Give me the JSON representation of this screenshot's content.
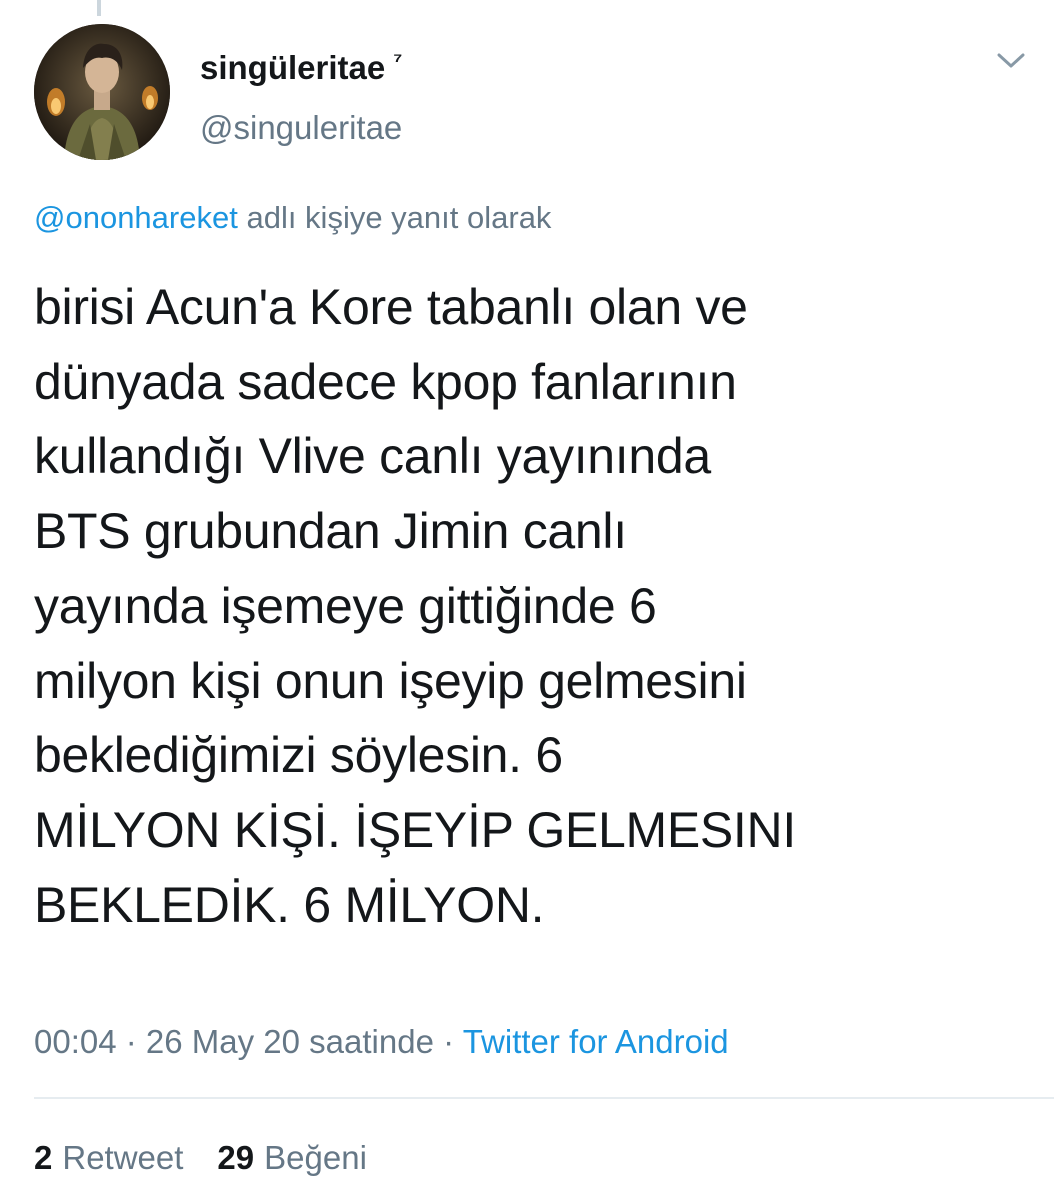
{
  "tweet": {
    "author": {
      "display_name": "singüleritae",
      "name_badge": "⁷",
      "handle": "@singuleritae"
    },
    "reply_context": {
      "mention": "@ononhareket",
      "suffix": " adlı kişiye yanıt olarak"
    },
    "text_lines": [
      "birisi Acun'a Kore tabanlı olan ve",
      "dünyada sadece kpop fanlarının",
      "kullandığı Vlive canlı yayınında",
      "BTS grubundan Jimin canlı",
      "yayında işemeye gittiğinde 6",
      "milyon kişi onun işeyip gelmesini",
      "beklediğimizi söylesin. 6",
      "MİLYON KİŞİ. İŞEYİP GELMESINI",
      "BEKLEDİK. 6 MİLYON."
    ],
    "meta": {
      "time": "00:04",
      "sep1": " · ",
      "date": "26 May 20 saatinde",
      "sep2": " · ",
      "source": "Twitter for Android"
    },
    "stats": {
      "retweets_count": "2",
      "retweets_label": "Retweet",
      "likes_count": "29",
      "likes_label": "Beğeni"
    }
  },
  "icons": {
    "more": "chevron-down-icon",
    "avatar": "avatar"
  },
  "colors": {
    "link": "#1b95e0",
    "secondary": "#657786",
    "primary_text": "#14171a",
    "divider": "#e6ecf0"
  }
}
